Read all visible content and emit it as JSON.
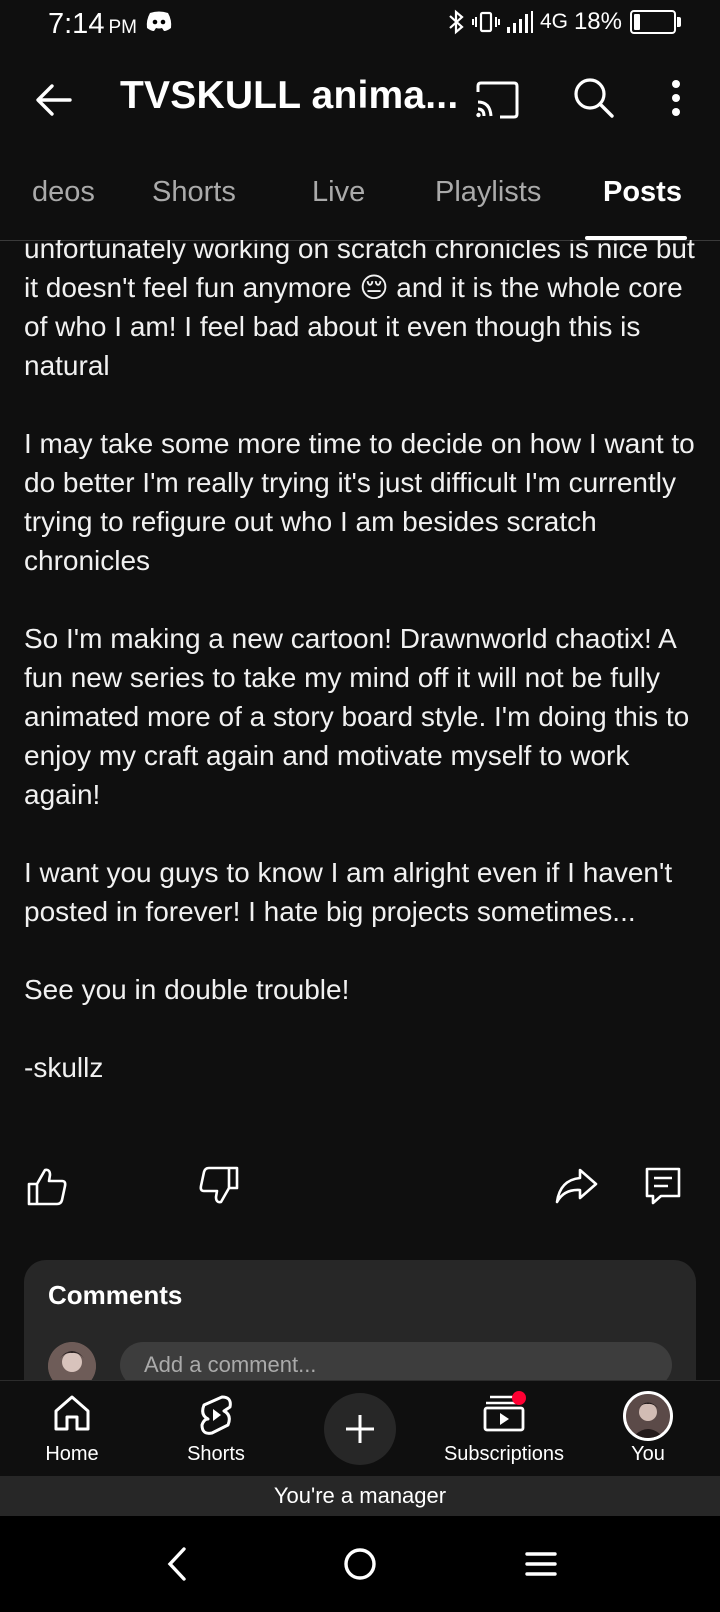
{
  "status_bar": {
    "time": "7:14",
    "ampm": "PM",
    "network": "4G",
    "battery_text": "18%",
    "battery_level": 0.18
  },
  "app_bar": {
    "channel_title": "TVSKULL anima..."
  },
  "tabs": [
    {
      "label": "deos",
      "active": false
    },
    {
      "label": "Shorts",
      "active": false
    },
    {
      "label": "Live",
      "active": false
    },
    {
      "label": "Playlists",
      "active": false
    },
    {
      "label": "Posts",
      "active": true
    }
  ],
  "post": {
    "paragraphs": [
      "unfortunately working on scratch chronicles is nice but it doesn't feel fun anymore 😔 and it is the whole core of who I am! I feel bad about it even though this is natural",
      "I may take some more time to decide on how I want to do better I'm really trying it's just difficult I'm currently trying to refigure out who I am besides scratch chronicles",
      "So I'm making a new cartoon! Drawnworld chaotix! A fun new series to take my mind off it will not be fully animated more of a story board style. I'm doing this to enjoy my craft again and motivate myself to work again!",
      "I want you guys to know I am alright even if I haven't posted in forever! I hate big projects sometimes...",
      "See you in double trouble!",
      "-skullz"
    ]
  },
  "comments": {
    "title": "Comments",
    "placeholder": "Add a comment..."
  },
  "bottom_nav": {
    "home": "Home",
    "shorts": "Shorts",
    "subscriptions": "Subscriptions",
    "you": "You"
  },
  "manager_banner": "You're a manager",
  "colors": {
    "background": "#0f0f0f",
    "card": "#272727",
    "notification": "#ff0033"
  }
}
